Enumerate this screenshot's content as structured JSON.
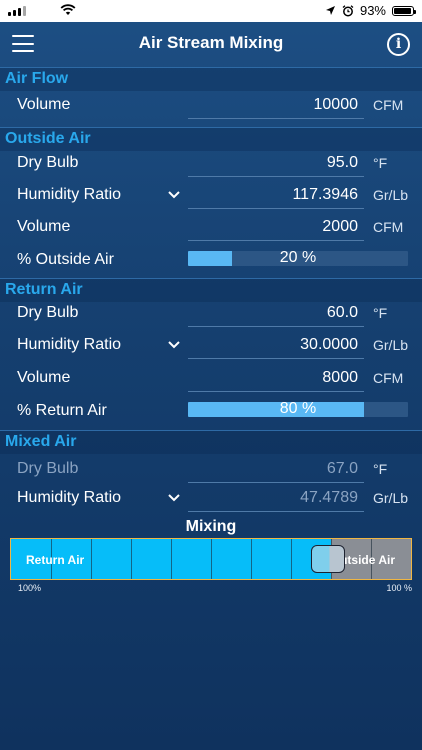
{
  "status": {
    "battery": "93%"
  },
  "nav": {
    "title": "Air Stream Mixing"
  },
  "sections": {
    "air_flow": "Air Flow",
    "outside_air": "Outside Air",
    "return_air": "Return Air",
    "mixed_air": "Mixed Air"
  },
  "air_flow": {
    "volume_label": "Volume",
    "volume_value": "10000",
    "volume_unit": "CFM"
  },
  "outside_air": {
    "dry_bulb_label": "Dry Bulb",
    "dry_bulb_value": "95.0",
    "dry_bulb_unit": "°F",
    "humidity_label": "Humidity Ratio",
    "humidity_value": "117.3946",
    "humidity_unit": "Gr/Lb",
    "volume_label": "Volume",
    "volume_value": "2000",
    "volume_unit": "CFM",
    "percent_label": "% Outside Air",
    "percent_text": "20 %",
    "percent": 20
  },
  "return_air": {
    "dry_bulb_label": "Dry Bulb",
    "dry_bulb_value": "60.0",
    "dry_bulb_unit": "°F",
    "humidity_label": "Humidity Ratio",
    "humidity_value": "30.0000",
    "humidity_unit": "Gr/Lb",
    "volume_label": "Volume",
    "volume_value": "8000",
    "volume_unit": "CFM",
    "percent_label": "% Return Air",
    "percent_text": "80 %",
    "percent": 80
  },
  "mixed_air": {
    "dry_bulb_label": "Dry Bulb",
    "dry_bulb_value": "67.0",
    "dry_bulb_unit": "°F",
    "humidity_label": "Humidity Ratio",
    "humidity_value": "47.4789",
    "humidity_unit": "Gr/Lb"
  },
  "mixing": {
    "title": "Mixing",
    "return_label": "Return Air",
    "outside_label": "Outside Air",
    "left_percent": "100%",
    "right_percent": "100 %",
    "return_fraction": 0.8
  },
  "colors": {
    "accent": "#29a8ec",
    "bar_fill": "#59b8f4",
    "mixer_return": "#06bdf9",
    "mixer_border": "#f0b643"
  }
}
